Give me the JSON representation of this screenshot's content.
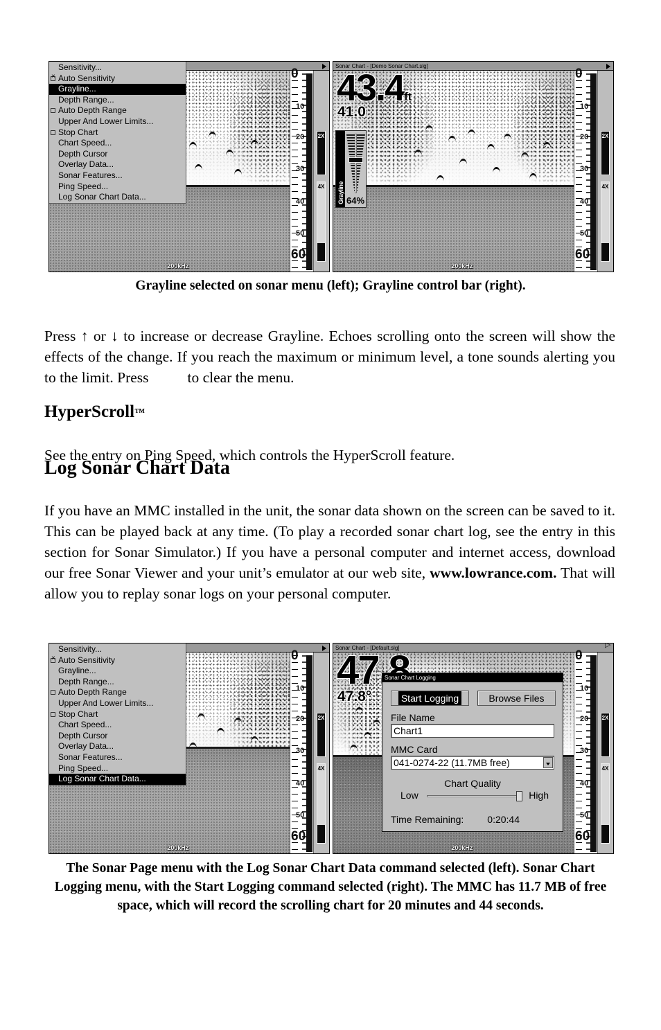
{
  "figure_top": {
    "left_panel": {
      "name": "sonar-page-menu",
      "menu_items": [
        {
          "label": "Sensitivity...",
          "checkbox": "none",
          "selected": false
        },
        {
          "label": "Auto Sensitivity",
          "checkbox": "checked",
          "selected": false
        },
        {
          "label": "Grayline...",
          "checkbox": "none",
          "selected": true
        },
        {
          "label": "Depth Range...",
          "checkbox": "none",
          "selected": false
        },
        {
          "label": "Auto Depth Range",
          "checkbox": "unchecked",
          "selected": false
        },
        {
          "label": "Upper And Lower Limits...",
          "checkbox": "none",
          "selected": false
        },
        {
          "label": "Stop Chart",
          "checkbox": "unchecked",
          "selected": false
        },
        {
          "label": "Chart Speed...",
          "checkbox": "none",
          "selected": false
        },
        {
          "label": "Depth Cursor",
          "checkbox": "none",
          "selected": false
        },
        {
          "label": "Overlay Data...",
          "checkbox": "none",
          "selected": false
        },
        {
          "label": "Sonar Features...",
          "checkbox": "none",
          "selected": false
        },
        {
          "label": "Ping Speed...",
          "checkbox": "none",
          "selected": false
        },
        {
          "label": "Log Sonar Chart Data...",
          "checkbox": "none",
          "selected": false
        }
      ],
      "scale_top": "0",
      "scale_bottom": "60",
      "scale_ticks": [
        "10",
        "20",
        "30",
        "40",
        "50"
      ],
      "zoom_bar_2x": "2X",
      "zoom_bar_4x": "4X",
      "frequency": "200kHz"
    },
    "right_panel": {
      "title": "Sonar Chart - [Demo Sonar Chart.slg]",
      "depth_large": "43.4",
      "depth_unit": "ft",
      "depth_small": "41.0",
      "grayline": {
        "label": "Grayline",
        "value": "64%"
      },
      "scale_top": "0",
      "scale_bottom": "60",
      "scale_ticks": [
        "10",
        "20",
        "30",
        "40",
        "50"
      ],
      "zoom_bar_2x": "2X",
      "zoom_bar_4x": "4X",
      "frequency": "200kHz"
    }
  },
  "caption_top": "Grayline selected on sonar menu (left); Grayline control bar (right).",
  "body": {
    "para1_a": "Press ↑ or ↓  to increase or decrease Grayline. Echoes scrolling onto the screen will show the effects of the change. If you reach the maximum or minimum level, a tone sounds alerting you to the limit. Press",
    "para1_b": "to clear the menu.",
    "heading_hyperscroll": "HyperScroll",
    "heading_hyperscroll_tm": "™",
    "para2": "See the entry on Ping Speed, which controls the HyperScroll feature.",
    "heading_log": "Log Sonar Chart Data",
    "para3_a": "If you have an MMC installed in the unit, the sonar data shown on the screen can be saved to it. This can be played back at any time. (To play a recorded sonar chart log, see the entry in this section for Sonar Simulator.) If you have a personal computer and internet access, download our free Sonar Viewer and your unit’s emulator at our web site,",
    "para3_site": "www.lowrance.com.",
    "para3_b": "That will allow you to replay sonar logs on your personal computer."
  },
  "figure_bottom": {
    "left_panel": {
      "name": "sonar-page-menu",
      "menu_items": [
        {
          "label": "Sensitivity...",
          "checkbox": "none",
          "selected": false
        },
        {
          "label": "Auto Sensitivity",
          "checkbox": "checked",
          "selected": false
        },
        {
          "label": "Grayline...",
          "checkbox": "none",
          "selected": false
        },
        {
          "label": "Depth Range...",
          "checkbox": "none",
          "selected": false
        },
        {
          "label": "Auto Depth Range",
          "checkbox": "unchecked",
          "selected": false
        },
        {
          "label": "Upper And Lower Limits...",
          "checkbox": "none",
          "selected": false
        },
        {
          "label": "Stop Chart",
          "checkbox": "unchecked",
          "selected": false
        },
        {
          "label": "Chart Speed...",
          "checkbox": "none",
          "selected": false
        },
        {
          "label": "Depth Cursor",
          "checkbox": "none",
          "selected": false
        },
        {
          "label": "Overlay Data...",
          "checkbox": "none",
          "selected": false
        },
        {
          "label": "Sonar Features...",
          "checkbox": "none",
          "selected": false
        },
        {
          "label": "Ping Speed...",
          "checkbox": "none",
          "selected": false
        },
        {
          "label": "Log Sonar Chart Data...",
          "checkbox": "none",
          "selected": true
        }
      ],
      "scale_top": "0",
      "scale_bottom": "60",
      "scale_ticks": [
        "10",
        "20",
        "30",
        "40",
        "50"
      ],
      "zoom_bar_2x": "2X",
      "zoom_bar_4x": "4X",
      "frequency": "200kHz"
    },
    "right_panel": {
      "title": "Sonar Chart - [Default.slg]",
      "depth_large": "47.8",
      "depth_small": "47.8°",
      "scale_top": "0",
      "scale_bottom": "60",
      "scale_ticks": [
        "10",
        "20",
        "30",
        "40",
        "50"
      ],
      "zoom_bar_2x": "2X",
      "zoom_bar_4x": "4X",
      "frequency": "200kHz",
      "dialog": {
        "title": "Sonar Chart Logging",
        "start_logging_button": "Start Logging",
        "browse_files_button": "Browse Files",
        "file_name_label": "File Name",
        "file_name_value": "Chart1",
        "mmc_card_label": "MMC Card",
        "mmc_card_value": "041-0274-22 (11.7MB free)",
        "quality_title": "Chart Quality",
        "quality_low": "Low",
        "quality_high": "High",
        "time_remaining_label": "Time Remaining:",
        "time_remaining_value": "0:20:44"
      }
    }
  },
  "caption_bottom": "The Sonar Page menu with the Log Sonar Chart Data command selected (left). Sonar Chart Logging menu, with the Start Logging command selected (right). The MMC has 11.7 MB of free space, which will record the scrolling chart for 20 minutes and 44 seconds."
}
